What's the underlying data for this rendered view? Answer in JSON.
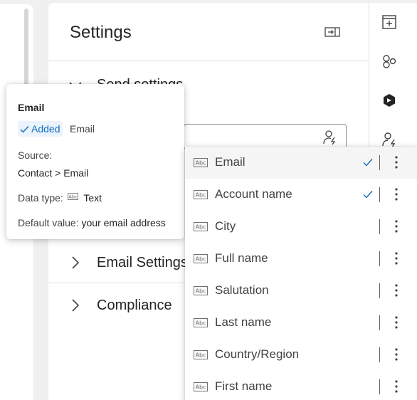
{
  "settings": {
    "title": "Settings",
    "sections": [
      {
        "label": "Send settings"
      },
      {
        "label": "Email Settings"
      },
      {
        "label": "Compliance"
      }
    ]
  },
  "tooltip": {
    "title": "Email",
    "added_label": "Added",
    "added_value": "Email",
    "source_label": "Source:",
    "source_value": "Contact > Email",
    "data_type_label": "Data type:",
    "data_type_value": "Text",
    "default_label": "Default value:",
    "default_value": "your email address"
  },
  "dropdown": {
    "items": [
      {
        "label": "Email",
        "checked": true,
        "selected": true
      },
      {
        "label": "Account name",
        "checked": true,
        "selected": false
      },
      {
        "label": "City",
        "checked": false,
        "selected": false
      },
      {
        "label": "Full name",
        "checked": false,
        "selected": false
      },
      {
        "label": "Salutation",
        "checked": false,
        "selected": false
      },
      {
        "label": "Last name",
        "checked": false,
        "selected": false
      },
      {
        "label": "Country/Region",
        "checked": false,
        "selected": false
      },
      {
        "label": "First name",
        "checked": false,
        "selected": false
      }
    ]
  },
  "colors": {
    "accent": "#0f6cbd",
    "badge_bg": "#ebf3fc",
    "selected_row": "#f5f5f5"
  },
  "icons": [
    "dock-panel-icon",
    "add-section-icon",
    "elements-icon",
    "copilot-icon",
    "personalize-icon",
    "person-lightning-icon",
    "abc-text-icon",
    "checkmark-icon",
    "more-vertical-icon",
    "chevron-icon"
  ]
}
